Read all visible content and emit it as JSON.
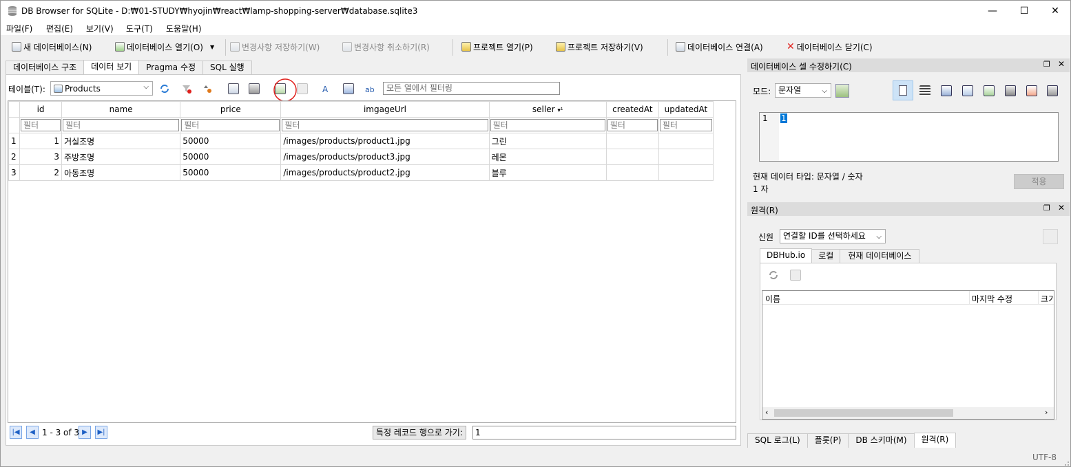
{
  "window": {
    "title": "DB Browser for SQLite - D:₩01-STUDY₩hyojin₩react₩lamp-shopping-server₩database.sqlite3",
    "minimize": "—",
    "maximize": "☐",
    "close": "✕"
  },
  "menu": [
    "파일(F)",
    "편집(E)",
    "보기(V)",
    "도구(T)",
    "도움말(H)"
  ],
  "toolbar": {
    "new_db": "새 데이터베이스(N)",
    "open_db": "데이터베이스 열기(O)",
    "write_changes": "변경사항 저장하기(W)",
    "revert_changes": "변경사항 취소하기(R)",
    "open_project": "프로젝트 열기(P)",
    "save_project": "프로젝트 저장하기(V)",
    "attach_db": "데이터베이스 연결(A)",
    "close_db": "데이터베이스 닫기(C)"
  },
  "main_tabs": [
    "데이터베이스 구조",
    "데이터 보기",
    "Pragma 수정",
    "SQL 실행"
  ],
  "browse": {
    "table_label": "테이블(T):",
    "table_value": "Products",
    "filter_placeholder": "모든 열에서 필터링",
    "columns": [
      "id",
      "name",
      "price",
      "imgageUrl",
      "seller",
      "createdAt",
      "updatedAt"
    ],
    "filter_text": "필터",
    "rows": [
      {
        "num": "1",
        "cells": [
          "1",
          "거실조명",
          "50000",
          "/images/products/product1.jpg",
          "그린",
          "",
          ""
        ]
      },
      {
        "num": "2",
        "cells": [
          "3",
          "주방조명",
          "50000",
          "/images/products/product3.jpg",
          "레몬",
          "",
          ""
        ]
      },
      {
        "num": "3",
        "cells": [
          "2",
          "아동조명",
          "50000",
          "/images/products/product2.jpg",
          "블루",
          "",
          ""
        ]
      }
    ],
    "sort_indicator": "▾¹",
    "record_count": "1 - 3 of 3",
    "goto_label": "특정 레코드 행으로 가기:",
    "goto_value": "1"
  },
  "edit_cell": {
    "title": "데이터베이스 셀 수정하기(C)",
    "mode_label": "모드:",
    "mode_value": "문자열",
    "line_number": "1",
    "cell_value": "1",
    "type_info": "현재 데이터 타입: 문자열 / 숫자",
    "size_info": "1 자",
    "apply": "적용"
  },
  "remote": {
    "title": "원격(R)",
    "identity_label": "신원",
    "identity_value": "연결할 ID를 선택하세요",
    "tabs": [
      "DBHub.io",
      "로컬",
      "현재 데이터베이스"
    ],
    "columns": [
      "이름",
      "마지막 수정",
      "크기"
    ]
  },
  "bottom_tabs": [
    "SQL 로그(L)",
    "플롯(P)",
    "DB 스키마(M)",
    "원격(R)"
  ],
  "status": {
    "encoding": "UTF-8"
  },
  "colors": {
    "annotation": "#e0201c",
    "selection": "#0078d7"
  }
}
